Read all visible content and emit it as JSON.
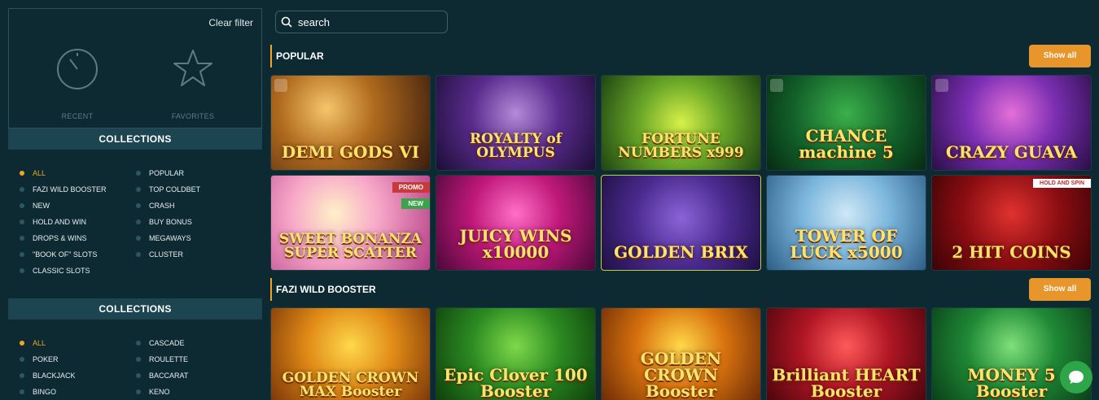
{
  "filter": {
    "clear_label": "Clear filter",
    "recent_label": "RECENT",
    "favorites_label": "FAVORITES"
  },
  "collections_1": {
    "title": "COLLECTIONS",
    "items": [
      "ALL",
      "POPULAR",
      "FAZI WILD BOOSTER",
      "TOP COLDBET",
      "NEW",
      "CRASH",
      "HOLD AND WIN",
      "BUY BONUS",
      "DROPS & WINS",
      "MEGAWAYS",
      "\"BOOK OF\" SLOTS",
      "CLUSTER",
      "CLASSIC SLOTS"
    ]
  },
  "collections_2": {
    "title": "COLLECTIONS",
    "items": [
      "ALL",
      "CASCADE",
      "POKER",
      "ROULETTE",
      "BLACKJACK",
      "BACCARAT",
      "BINGO",
      "KENO"
    ]
  },
  "search": {
    "placeholder": "search"
  },
  "popular": {
    "title": "POPULAR",
    "show_all": "Show all",
    "games": [
      "DEMI GODS VI",
      "ROYALTY of OLYMPUS",
      "FORTUNE NUMBERS x999",
      "CHANCE machine 5",
      "CRAZY GUAVA",
      "SWEET BONANZA SUPER SCATTER",
      "JUICY WINS x10000",
      "GOLDEN BRIX",
      "TOWER OF LUCK x5000",
      "2 HIT COINS"
    ],
    "badges": {
      "promo": "PROMO",
      "new": "NEW",
      "hold": "HOLD AND SPIN"
    }
  },
  "fazi": {
    "title": "FAZI WILD BOOSTER",
    "show_all": "Show all",
    "games": [
      "GOLDEN CROWN MAX Booster",
      "Epic Clover 100 Booster",
      "GOLDEN CROWN Booster",
      "Brilliant HEART Booster",
      "MONEY 5 Booster"
    ]
  },
  "colors": {
    "accent": "#f0a529",
    "button": "#e8952b",
    "background": "#0d2a33",
    "chat": "#2fa54a"
  }
}
